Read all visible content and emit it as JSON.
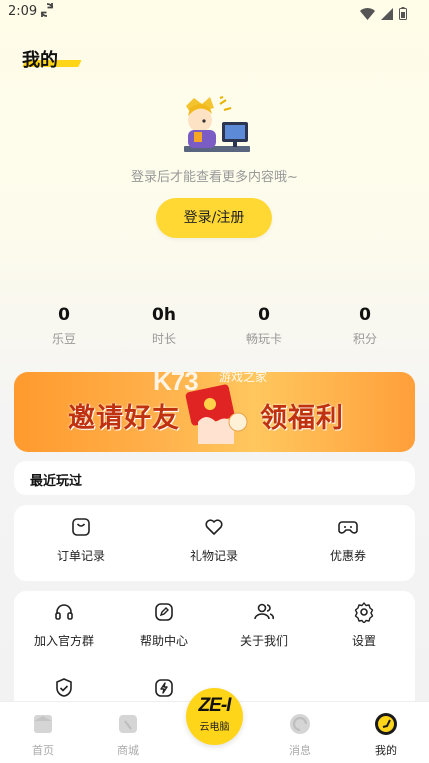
{
  "status_bar": {
    "time": "2:09",
    "sync_icon": "sync-icon",
    "wifi_icon": "wifi-icon",
    "signal_icon": "signal-icon",
    "battery_icon": "battery-icon"
  },
  "page": {
    "title": "我的",
    "accent": "#ffd51a"
  },
  "profile": {
    "login_hint": "登录后才能查看更多内容哦~",
    "login_button": "登录/注册",
    "avatar_icon": "cartoon-avatar"
  },
  "stats": [
    {
      "value": "0",
      "label": "乐豆"
    },
    {
      "value": "0h",
      "label": "时长"
    },
    {
      "value": "0",
      "label": "畅玩卡"
    },
    {
      "value": "0",
      "label": "积分"
    }
  ],
  "banner": {
    "left_text": "邀请好友",
    "right_text": "领福利",
    "art_icon": "gift-envelope"
  },
  "watermark": {
    "logo": "K73",
    "text": "游戏之家"
  },
  "recent": {
    "title": "最近玩过"
  },
  "orders": [
    {
      "label": "订单记录",
      "icon": "bag-icon"
    },
    {
      "label": "礼物记录",
      "icon": "heart-icon"
    },
    {
      "label": "优惠券",
      "icon": "gamepad-icon"
    }
  ],
  "services": [
    {
      "label": "加入官方群",
      "icon": "headset-icon"
    },
    {
      "label": "帮助中心",
      "icon": "edit-icon"
    },
    {
      "label": "关于我们",
      "icon": "users-icon"
    },
    {
      "label": "设置",
      "icon": "gear-icon"
    }
  ],
  "services_row2": [
    {
      "icon": "shield-check-icon"
    },
    {
      "icon": "lightning-icon"
    }
  ],
  "tabbar": {
    "home": "首页",
    "mall": "商城",
    "center_logo": "ZE-I",
    "center_label": "云电脑",
    "messages": "消息",
    "mine": "我的"
  }
}
